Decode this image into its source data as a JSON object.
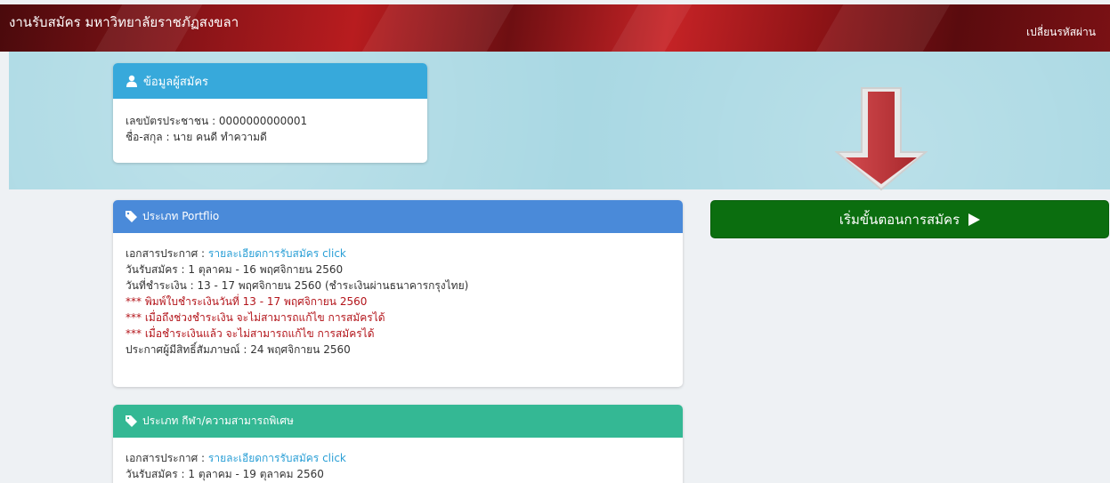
{
  "header": {
    "title": "งานรับสมัคร มหาวิทยาลัยราชภัฏสงขลา",
    "change_password": "เปลี่ยนรหัสผ่าน"
  },
  "applicant": {
    "heading": "ข้อมูลผู้สมัคร",
    "icon": "user-icon",
    "id_line": "เลขบัตรประชาชน : 0000000000001",
    "name_line": "ชื่อ-สกุล : นาย คนดี ทำความดี"
  },
  "start_button": {
    "label": "เริ่มขั้นตอนการสมัคร",
    "icon": "play-icon"
  },
  "portfolio": {
    "heading": "ประเภท Portflio",
    "icon": "tag-icon",
    "doc_label": "เอกสารประกาศ : ",
    "doc_link": "รายละเอียดการรับสมัคร click",
    "lines": [
      "วันรับสมัคร : 1 ตุลาคม - 16 พฤศจิกายน 2560",
      "วันที่ชำระเงิน : 13 - 17 พฤศจิกายน 2560 (ชำระเงินผ่านธนาคารกรุงไทย)"
    ],
    "warnings": [
      "*** พิมพ์ใบชำระเงินวันที่ 13 - 17 พฤศจิกายน 2560",
      "*** เมื่อถึงช่วงชำระเงิน จะไม่สามารถแก้ไข การสมัครได้",
      "*** เมื่อชำระเงินแล้ว จะไม่สามารถแก้ไข การสมัครได้"
    ],
    "announce": "ประกาศผู้มีสิทธิ์สัมภาษณ์ : 24 พฤศจิกายน 2560"
  },
  "sport": {
    "heading": "ประเภท กีฬา/ความสามารถพิเศษ",
    "icon": "tag-icon",
    "doc_label": "เอกสารประกาศ : ",
    "doc_link": "รายละเอียดการรับสมัคร click",
    "lines": [
      "วันรับสมัคร : 1 ตุลาคม - 19 ตุลาคม 2560"
    ]
  },
  "colors": {
    "header_red": "#b81c1f",
    "hero_blue": "#a9d8e3",
    "applicant_header": "#37a9db",
    "portfolio_header": "#4a8ad9",
    "sport_header": "#34b894",
    "start_button": "#0b6e0f",
    "warning_red": "#b3141a",
    "link_blue": "#2a9fd6",
    "arrow_red": "#c0393d"
  }
}
